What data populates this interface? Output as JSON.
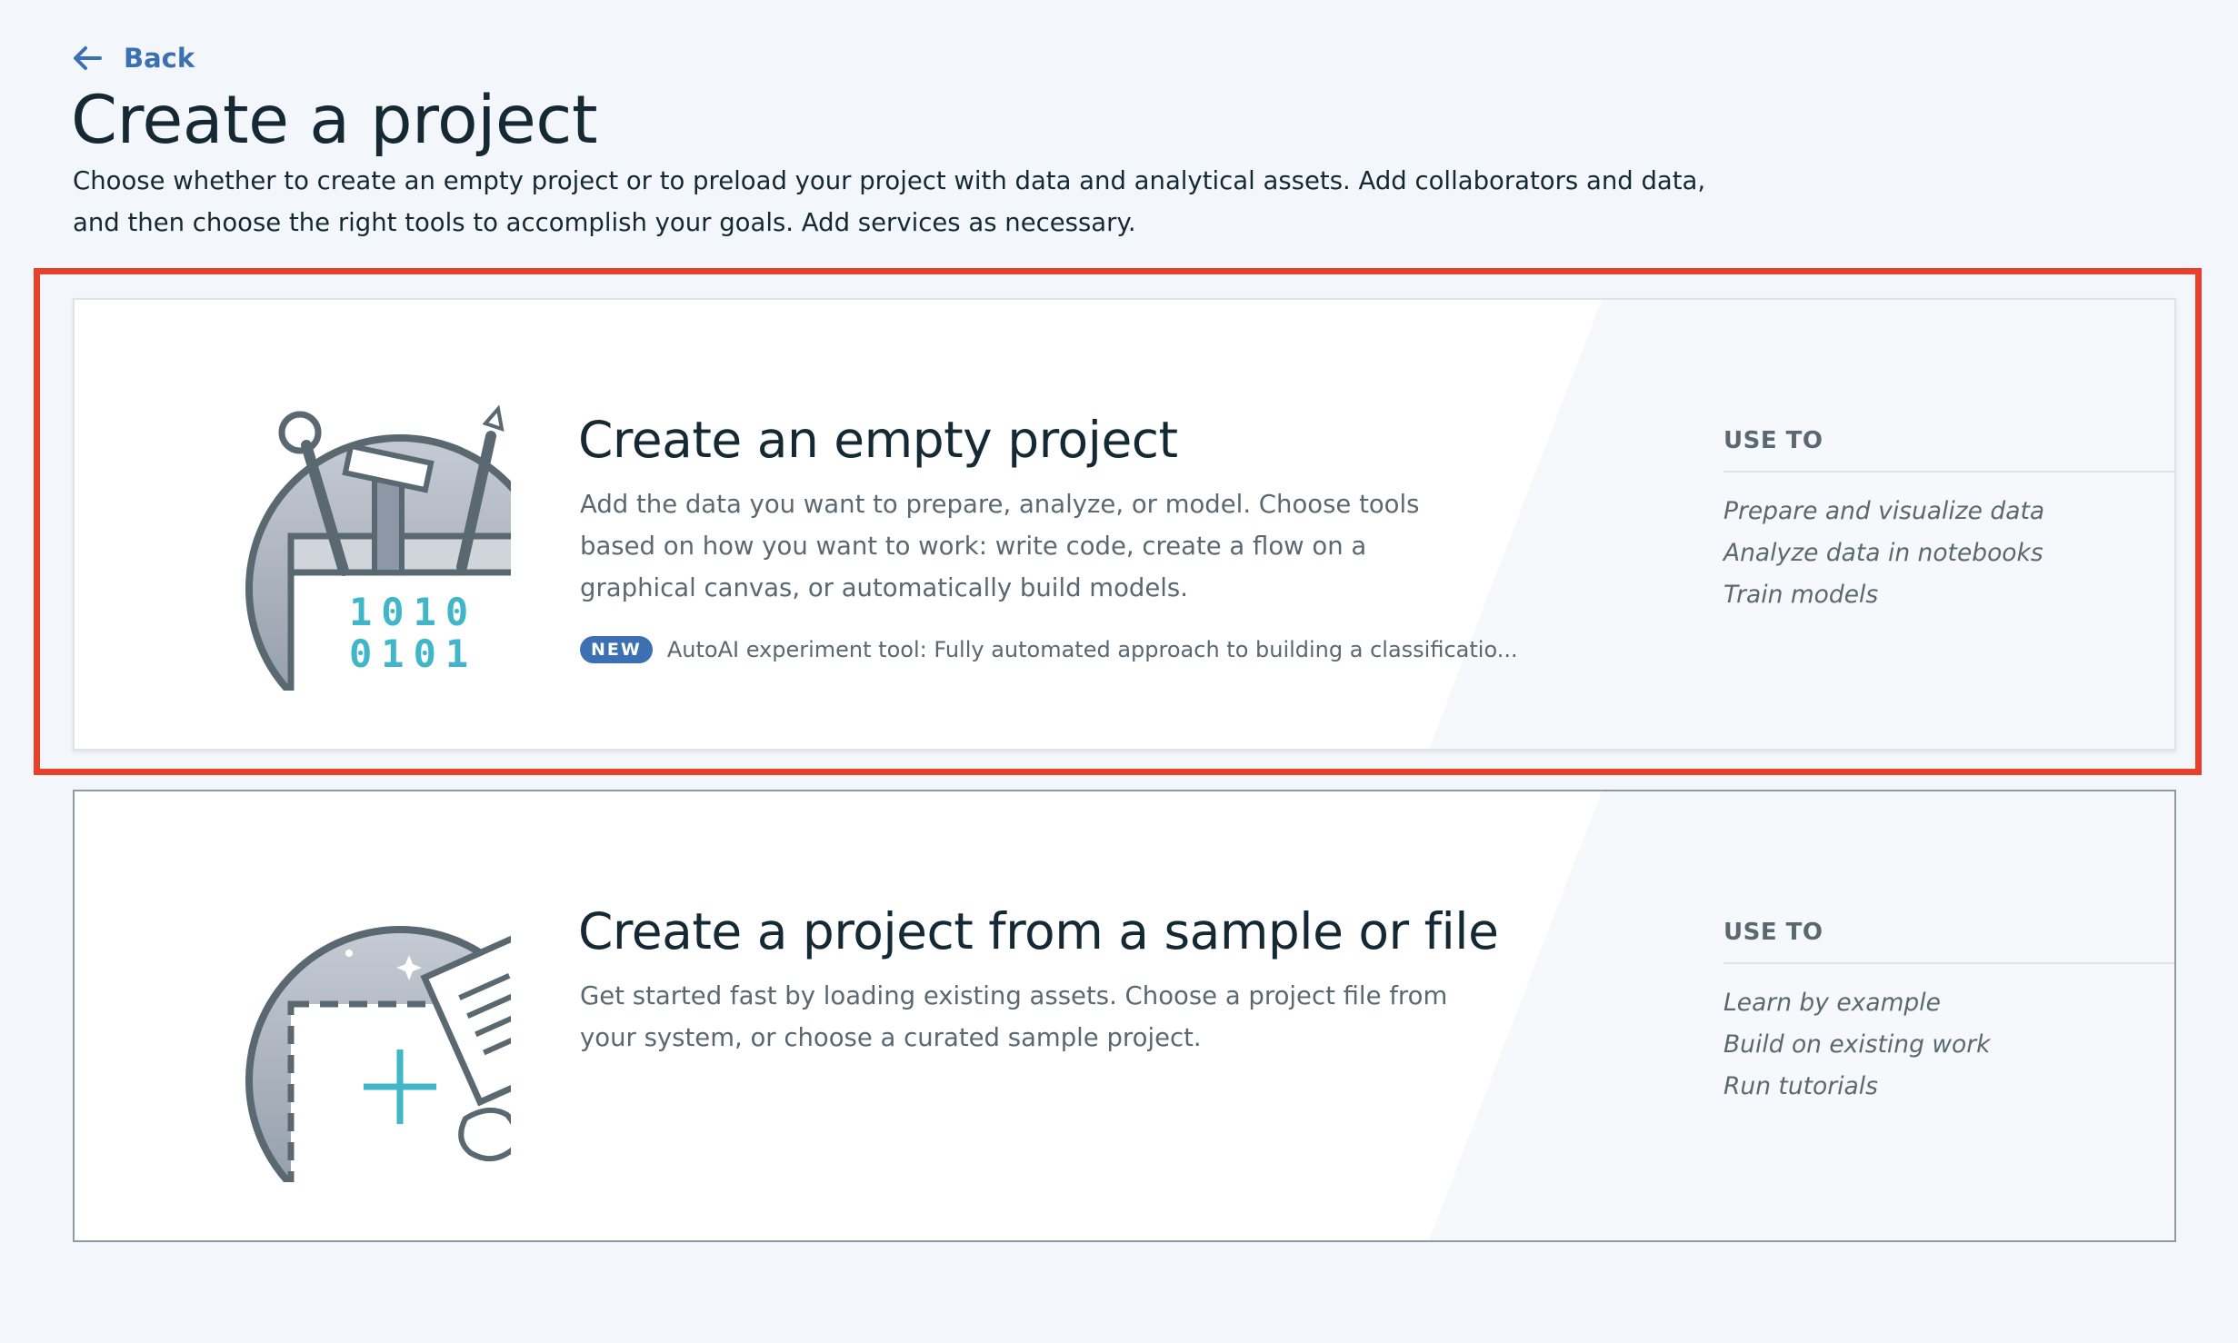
{
  "back": {
    "label": "Back"
  },
  "page": {
    "title": "Create a project",
    "description": "Choose whether to create an empty project or to preload your project with data and analytical assets. Add collaborators and data, and then choose the right tools to accomplish your goals. Add services as necessary."
  },
  "cards": [
    {
      "title": "Create an empty project",
      "body": "Add the data you want to prepare, analyze, or model. Choose tools based on how you want to work: write code, create a flow on a graphical canvas, or automatically build models.",
      "badge": "NEW",
      "badge_text": "AutoAI experiment tool: Fully automated approach to building a classificatio...",
      "use_heading": "USE TO",
      "use_items": [
        "Prepare and visualize data",
        "Analyze data in notebooks",
        "Train models"
      ],
      "illustration": {
        "icon": "toolbox-icon",
        "binary_line_1": "1010",
        "binary_line_2": "0101"
      }
    },
    {
      "title": "Create a project from a sample or file",
      "body": "Get started fast by loading existing assets. Choose a project file from your system, or choose a curated sample project.",
      "use_heading": "USE TO",
      "use_items": [
        "Learn by example",
        "Build on existing work",
        "Run tutorials"
      ],
      "illustration": {
        "icon": "add-file-icon"
      }
    }
  ],
  "colors": {
    "accent": "#3d70b2",
    "highlight": "#e7412c",
    "teal": "#41b6c8"
  }
}
